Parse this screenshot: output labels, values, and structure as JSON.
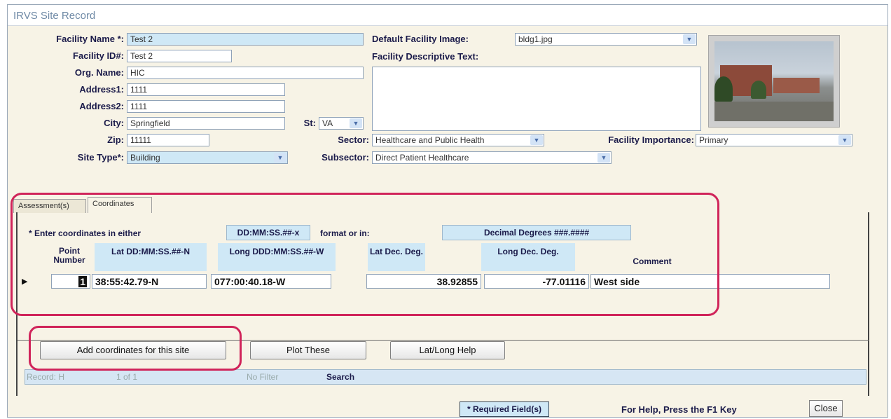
{
  "window": {
    "title": "IRVS Site Record"
  },
  "form": {
    "facility_name_label": "Facility Name *:",
    "facility_name": "Test 2",
    "facility_id_label": "Facility ID#:",
    "facility_id": "Test 2",
    "org_name_label": "Org. Name:",
    "org_name": "HIC",
    "address1_label": "Address1:",
    "address1": "1111",
    "address2_label": "Address2:",
    "address2": "1111",
    "city_label": "City:",
    "city": "Springfield",
    "st_label": "St:",
    "st": "VA",
    "zip_label": "Zip:",
    "zip": "11111",
    "site_type_label": "Site Type*:",
    "site_type": "Building",
    "default_image_label": "Default Facility Image:",
    "default_image": "bldg1.jpg",
    "descriptive_text_label": "Facility Descriptive Text:",
    "descriptive_text": "",
    "sector_label": "Sector:",
    "sector": "Healthcare and Public Health",
    "subsector_label": "Subsector:",
    "subsector": "Direct Patient Healthcare",
    "importance_label": "Facility Importance:",
    "importance": "Primary"
  },
  "tabs": [
    {
      "label": "Assessment(s)"
    },
    {
      "label": "Coordinates"
    }
  ],
  "coordinates": {
    "instruction_prefix": "* Enter coordinates in either",
    "format1": "DD:MM:SS.##-x",
    "instruction_mid": "format or in:",
    "format2": "Decimal Degrees ###.####",
    "headers": {
      "point_number": "Point Number",
      "lat_dms": "Lat DD:MM:SS.##-N",
      "long_dms": "Long DDD:MM:SS.##-W",
      "lat_dec": "Lat Dec. Deg.",
      "long_dec": "Long Dec. Deg.",
      "comment": "Comment"
    },
    "rows": [
      {
        "point_number": "1",
        "lat_dms": "38:55:42.79-N",
        "long_dms": "077:00:40.18-W",
        "lat_dec": "38.92855",
        "long_dec": "-77.01116",
        "comment": "West side"
      }
    ]
  },
  "buttons": {
    "add_coords": "Add coordinates for this site",
    "plot": "Plot These",
    "help": "Lat/Long Help",
    "close": "Close"
  },
  "record_nav": {
    "record_label": "Record: H",
    "position": "1 of 1",
    "filter": "No Filter",
    "search": "Search"
  },
  "status": {
    "required": "* Required Field(s)",
    "help_text": "For Help, Press the F1 Key"
  },
  "colors": {
    "highlight": "#d0245a",
    "field_blue": "#cfe8f6",
    "window_bg": "#f7f3e6"
  }
}
